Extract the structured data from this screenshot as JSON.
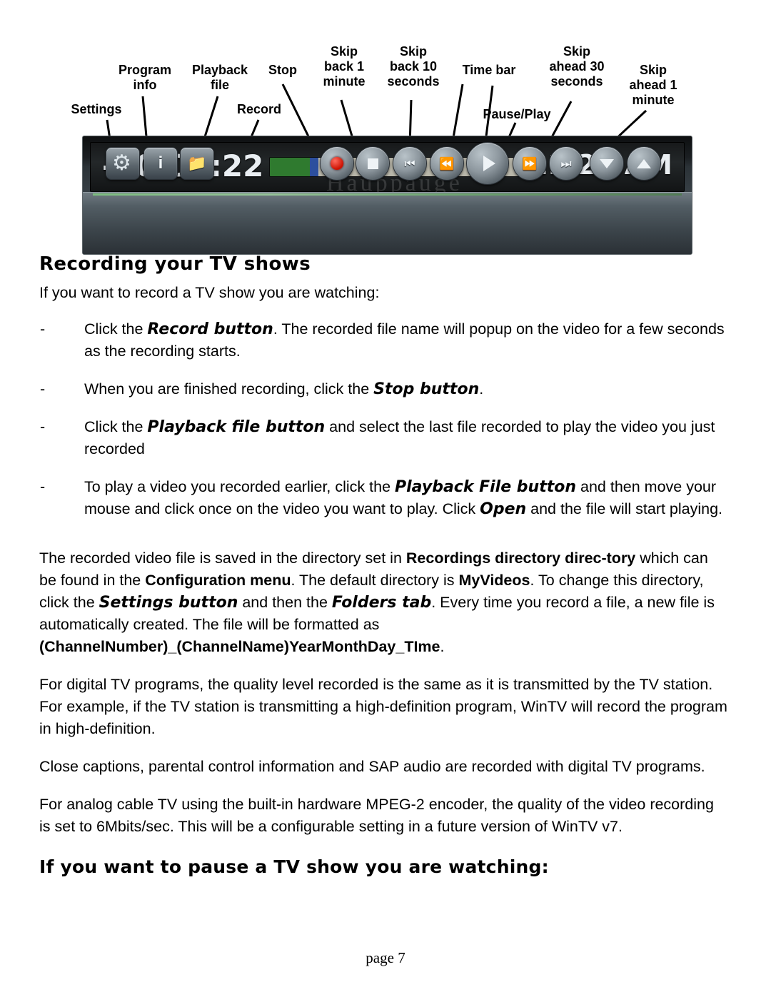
{
  "diagram": {
    "callouts": [
      {
        "id": "settings",
        "label": "Settings"
      },
      {
        "id": "program-info",
        "label": "Program\ninfo"
      },
      {
        "id": "playback-file",
        "label": "Playback\nfile"
      },
      {
        "id": "record",
        "label": "Record"
      },
      {
        "id": "stop",
        "label": "Stop"
      },
      {
        "id": "skip-back-1-minute",
        "label": "Skip\nback 1\nminute"
      },
      {
        "id": "skip-back-10-seconds",
        "label": "Skip\nback 10\nseconds"
      },
      {
        "id": "time-bar",
        "label": "Time bar"
      },
      {
        "id": "pause-play",
        "label": "Pause/Play"
      },
      {
        "id": "skip-ahead-30-seconds",
        "label": "Skip\nahead 30\nseconds"
      },
      {
        "id": "skip-ahead-1-minute",
        "label": "Skip\nahead 1\nminute"
      }
    ],
    "toolbar": {
      "elapsed": "-00:00:22",
      "clock": "11:26 AM",
      "watermark": "Hauppauge"
    }
  },
  "body": {
    "heading": "Recording your TV shows",
    "intro": "If you want to record a TV show you are watching:",
    "bullets": [
      {
        "dash": "-",
        "parts": [
          {
            "t": "Click the ",
            "s": "plain"
          },
          {
            "t": "Record button",
            "s": "ital-bold"
          },
          {
            "t": ". The recorded file name will popup on the video for a few seconds as the recording starts.",
            "s": "plain"
          }
        ]
      },
      {
        "dash": "-",
        "parts": [
          {
            "t": "When you are finished recording, click the ",
            "s": "plain"
          },
          {
            "t": "Stop button",
            "s": "ital-bold"
          },
          {
            "t": ".",
            "s": "plain"
          }
        ]
      },
      {
        "dash": "-",
        "parts": [
          {
            "t": "Click the ",
            "s": "plain"
          },
          {
            "t": "Playback file button",
            "s": "ital-bold"
          },
          {
            "t": " and select the last file recorded to play the video you just recorded",
            "s": "plain"
          }
        ]
      },
      {
        "dash": "-",
        "parts": [
          {
            "t": "To play a video you recorded earlier, click the ",
            "s": "plain"
          },
          {
            "t": "Playback File button",
            "s": "ital-bold"
          },
          {
            "t": " and then move your mouse and click once on the video you want to play. Click ",
            "s": "plain"
          },
          {
            "t": "Open",
            "s": "ital-bold"
          },
          {
            "t": " and the file will start playing.",
            "s": "plain"
          }
        ]
      }
    ],
    "paragraphs": [
      {
        "id": "para-directory",
        "parts": [
          {
            "t": "The recorded video file is saved in the directory set in ",
            "s": "plain"
          },
          {
            "t": "Recordings directory direc-tory",
            "s": "bold"
          },
          {
            "t": " which can be found in the ",
            "s": "plain"
          },
          {
            "t": "Configuration menu",
            "s": "bold"
          },
          {
            "t": ". The default directory is ",
            "s": "plain"
          },
          {
            "t": "MyVideos",
            "s": "bold"
          },
          {
            "t": ". To change this directory, click the ",
            "s": "plain"
          },
          {
            "t": "Settings button",
            "s": "ital-bold"
          },
          {
            "t": " and then the ",
            "s": "plain"
          },
          {
            "t": "Folders tab",
            "s": "ital-bold"
          },
          {
            "t": ". Every time you record a file, a new file is automatically created. The file will be formatted as ",
            "s": "plain"
          },
          {
            "t": "(ChannelNumber)_(ChannelName)YearMonthDay_TIme",
            "s": "bold"
          },
          {
            "t": ".",
            "s": "plain"
          }
        ]
      },
      {
        "id": "para-digital",
        "parts": [
          {
            "t": "For digital TV programs, the quality level recorded is the same as it is transmitted by the TV station. For example, if the TV station is transmitting a high-definition program, WinTV will record the program in high-definition.",
            "s": "plain"
          }
        ]
      },
      {
        "id": "para-captions",
        "parts": [
          {
            "t": "Close captions, parental control information and SAP audio are recorded with digital TV programs.",
            "s": "plain"
          }
        ]
      },
      {
        "id": "para-analog",
        "parts": [
          {
            "t": "For analog cable TV using the built-in hardware MPEG-2 encoder, the quality of the video recording is set to 6Mbits/sec. This will be a configurable setting in a future version of WinTV v7.",
            "s": "plain"
          }
        ]
      }
    ],
    "heading2": "If you want to pause a TV show you are watching:"
  },
  "footer": {
    "page": "page 7"
  }
}
